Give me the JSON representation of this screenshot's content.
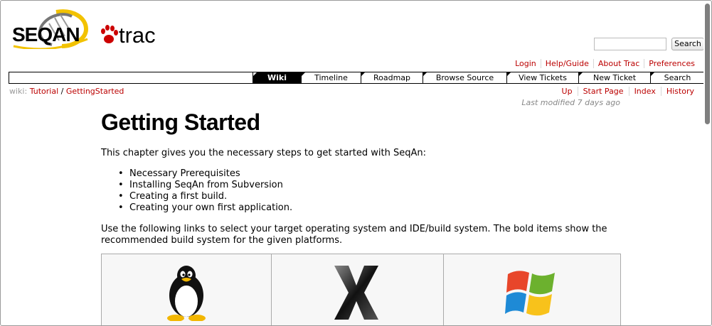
{
  "logo": {
    "seqan_text": "SEQAN",
    "trac_text": "trac"
  },
  "search": {
    "value": "",
    "button_label": "Search"
  },
  "metanav": [
    "Login",
    "Help/Guide",
    "About Trac",
    "Preferences"
  ],
  "mainnav": [
    {
      "label": "Wiki",
      "active": true
    },
    {
      "label": "Timeline",
      "active": false
    },
    {
      "label": "Roadmap",
      "active": false
    },
    {
      "label": "Browse Source",
      "active": false
    },
    {
      "label": "View Tickets",
      "active": false
    },
    {
      "label": "New Ticket",
      "active": false
    },
    {
      "label": "Search",
      "active": false
    }
  ],
  "breadcrumb": {
    "prefix": "wiki:",
    "parent": "Tutorial",
    "separator": " / ",
    "current": "GettingStarted"
  },
  "ctxtnav": [
    "Up",
    "Start Page",
    "Index",
    "History"
  ],
  "last_modified": "Last modified 7 days ago",
  "page": {
    "title": "Getting Started",
    "intro": "This chapter gives you the necessary steps to get started with SeqAn:",
    "steps": [
      "Necessary Prerequisites",
      "Installing SeqAn from Subversion",
      "Creating a first build.",
      "Creating your own first application."
    ],
    "paragraph": "Use the following links to select your target operating system and IDE/build system. The bold items show the recommended build system for the given platforms."
  },
  "platforms": [
    {
      "icon": "linux-tux-icon"
    },
    {
      "icon": "mac-os-x-icon"
    },
    {
      "icon": "windows-logo-icon"
    }
  ],
  "colors": {
    "link": "#bb0000",
    "nav_active_bg": "#000000",
    "muted": "#888888"
  }
}
